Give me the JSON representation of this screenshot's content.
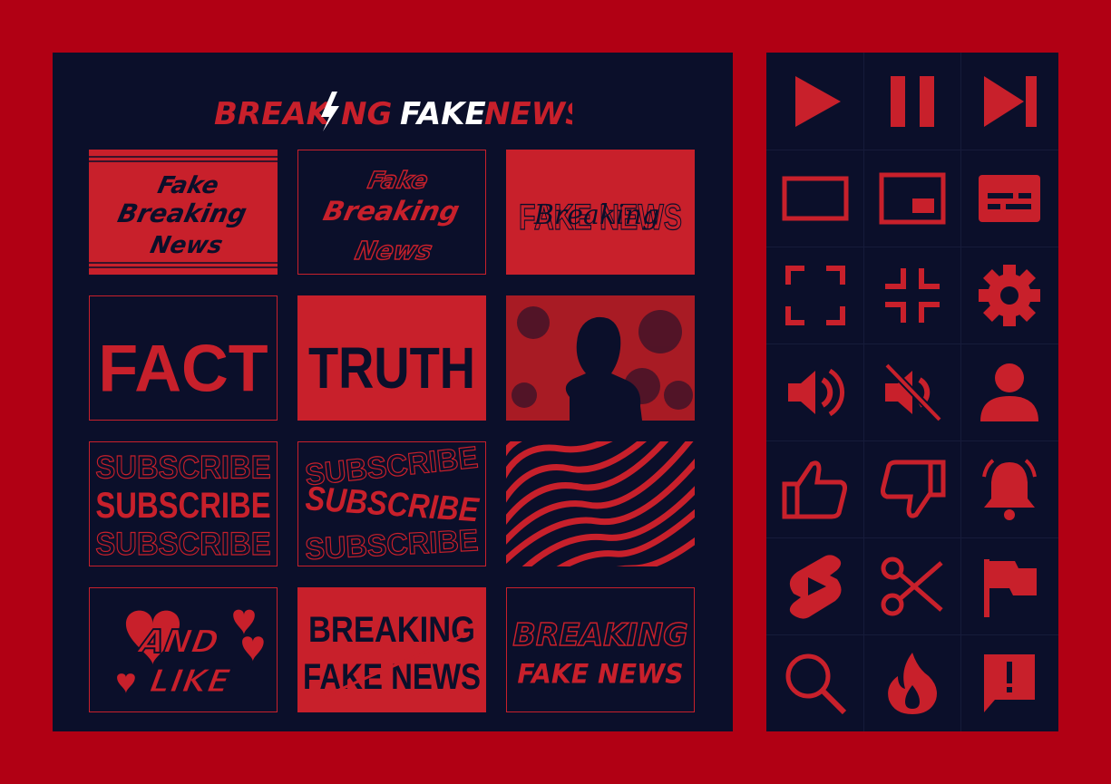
{
  "header": {
    "word1": "BREAK",
    "bolt": "I",
    "word1_end": "NG",
    "word2": "FAKE",
    "word3": "NEWS"
  },
  "tiles": [
    {
      "name": "tile-fake-breaking-news-filled",
      "lines": [
        "Fake",
        "Breaking",
        "News"
      ]
    },
    {
      "name": "tile-fake-breaking-news-outline",
      "lines": [
        "Fake",
        "Breaking",
        "News"
      ]
    },
    {
      "name": "tile-breaking-fake-news-script",
      "lines": [
        "FAKE NEWS",
        "Breaking"
      ]
    },
    {
      "name": "tile-fact",
      "lines": [
        "FACT"
      ]
    },
    {
      "name": "tile-truth",
      "lines": [
        "TRUTH"
      ]
    },
    {
      "name": "tile-silhouette-photo",
      "lines": []
    },
    {
      "name": "tile-subscribe-straight",
      "lines": [
        "SUBSCRIBE",
        "SUBSCRIBE",
        "SUBSCRIBE"
      ]
    },
    {
      "name": "tile-subscribe-wave",
      "lines": [
        "SUBSCRIBE",
        "SUBSCRIBE",
        "SUBSCRIBE"
      ]
    },
    {
      "name": "tile-zebra-stripes",
      "lines": []
    },
    {
      "name": "tile-and-like",
      "lines": [
        "AND",
        "LIKE"
      ]
    },
    {
      "name": "tile-breaking-fake-news-block",
      "lines": [
        "BREAKING",
        "FAKE NEWS"
      ]
    },
    {
      "name": "tile-breaking-fake-news-italic",
      "lines": [
        "BREAKING",
        "FAKE NEWS"
      ]
    }
  ],
  "icons": [
    "play-icon",
    "pause-icon",
    "skip-next-icon",
    "theater-mode-icon",
    "miniplayer-icon",
    "captions-icon",
    "fullscreen-icon",
    "exit-fullscreen-icon",
    "settings-gear-icon",
    "volume-icon",
    "mute-icon",
    "user-icon",
    "thumbs-up-icon",
    "thumbs-down-icon",
    "bell-icon",
    "shorts-icon",
    "scissors-icon",
    "flag-icon",
    "search-icon",
    "fire-icon",
    "report-icon"
  ],
  "colors": {
    "background": "#b10014",
    "panel": "#0b0f2a",
    "accent": "#c8202b",
    "white": "#ffffff"
  }
}
